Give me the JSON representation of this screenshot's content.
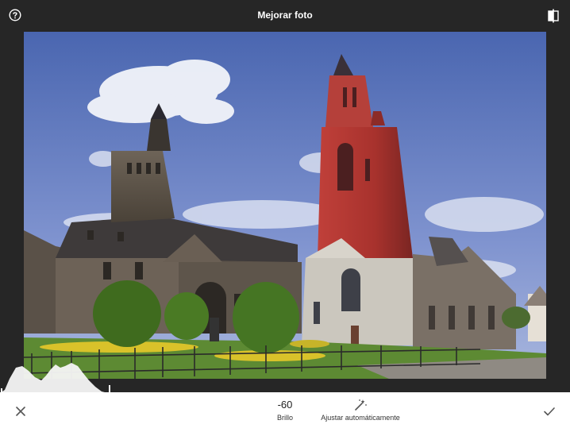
{
  "header": {
    "title": "Mejorar foto",
    "left_icon": "help-circle-icon",
    "right_icon": "compare-split-icon"
  },
  "editor": {
    "parameter_value": "-60",
    "parameter_name": "Brillo",
    "auto_adjust_label": "Ajustar automáticamente",
    "auto_adjust_icon": "magic-wand-icon",
    "cancel_icon": "close-icon",
    "confirm_icon": "check-icon"
  },
  "colors": {
    "dark_background": "#262626",
    "bottom_bar": "#ffffff"
  }
}
